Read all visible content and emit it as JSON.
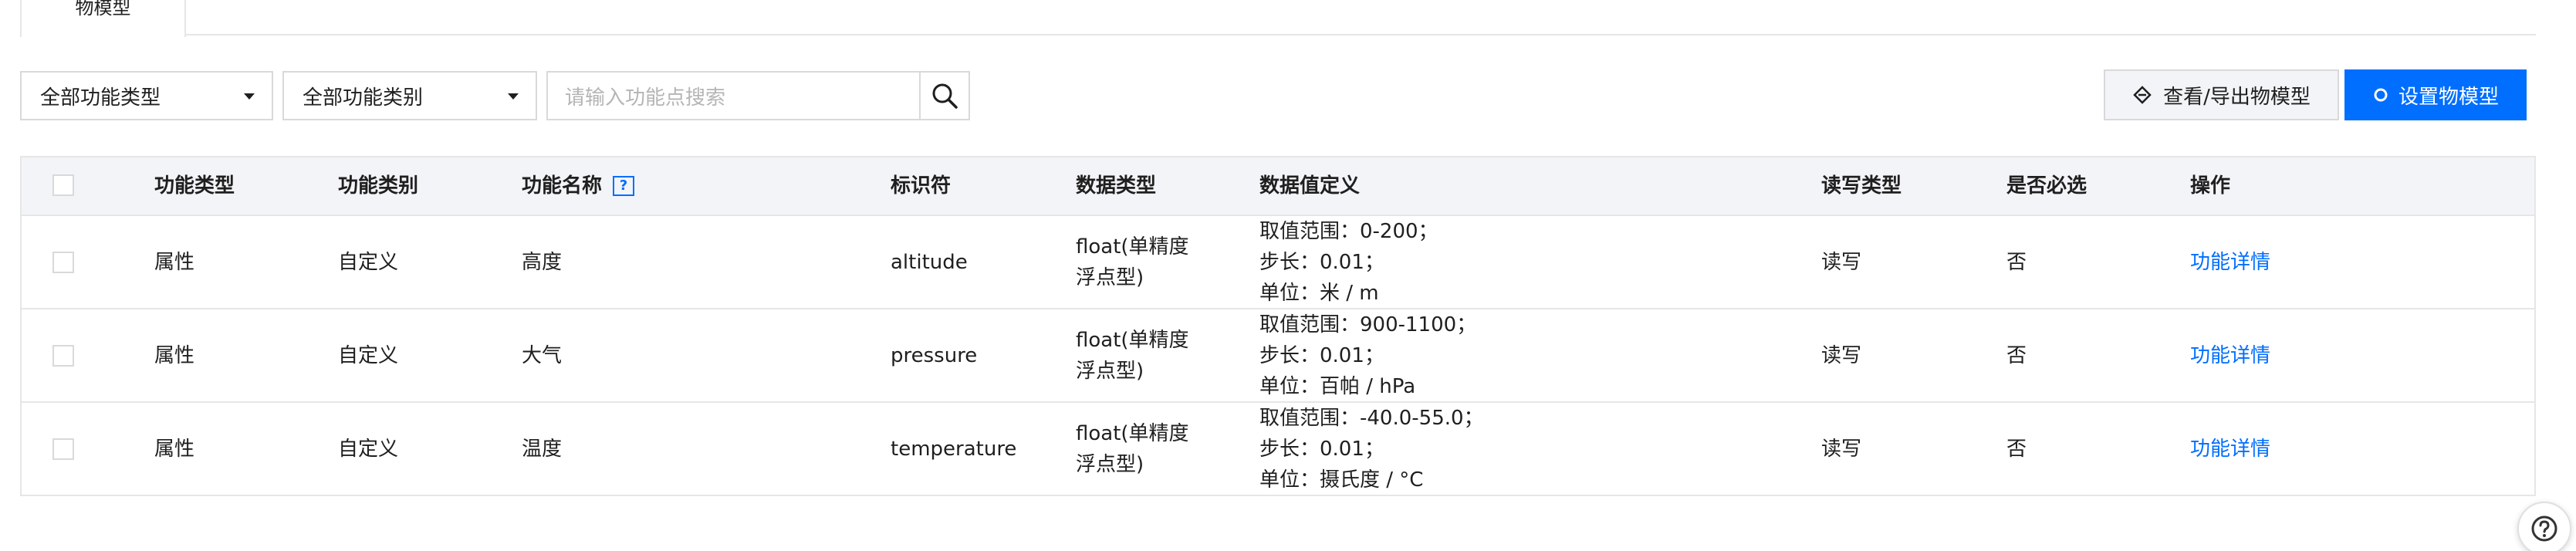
{
  "tabs": [
    {
      "label": "物模型"
    }
  ],
  "toolbar": {
    "type_filter": "全部功能类型",
    "category_filter": "全部功能类别",
    "search_placeholder": "请输入功能点搜索",
    "view_export_label": "查看/导出物模型",
    "set_model_label": "设置物模型"
  },
  "table": {
    "headers": {
      "type": "功能类型",
      "category": "功能类别",
      "name": "功能名称",
      "identifier": "标识符",
      "data_type": "数据类型",
      "data_def": "数据值定义",
      "rw": "读写类型",
      "required": "是否必选",
      "action": "操作"
    },
    "rows": [
      {
        "type": "属性",
        "category": "自定义",
        "name": "高度",
        "identifier": "altitude",
        "data_type_1": "float(单精度",
        "data_type_2": "浮点型)",
        "def_1": "取值范围：0-200；",
        "def_2": "步长：0.01；",
        "def_3": "单位：米 / m",
        "rw": "读写",
        "required": "否",
        "action": "功能详情"
      },
      {
        "type": "属性",
        "category": "自定义",
        "name": "大气",
        "identifier": "pressure",
        "data_type_1": "float(单精度",
        "data_type_2": "浮点型)",
        "def_1": "取值范围：900-1100；",
        "def_2": "步长：0.01；",
        "def_3": "单位：百帕 / hPa",
        "rw": "读写",
        "required": "否",
        "action": "功能详情"
      },
      {
        "type": "属性",
        "category": "自定义",
        "name": "温度",
        "identifier": "temperature",
        "data_type_1": "float(单精度",
        "data_type_2": "浮点型)",
        "def_1": "取值范围：-40.0-55.0；",
        "def_2": "步长：0.01；",
        "def_3": "单位：摄氏度 / °C",
        "rw": "读写",
        "required": "否",
        "action": "功能详情"
      }
    ]
  },
  "colors": {
    "primary": "#006eff",
    "border": "#e6e6e6",
    "header_bg": "#f2f4f8"
  }
}
